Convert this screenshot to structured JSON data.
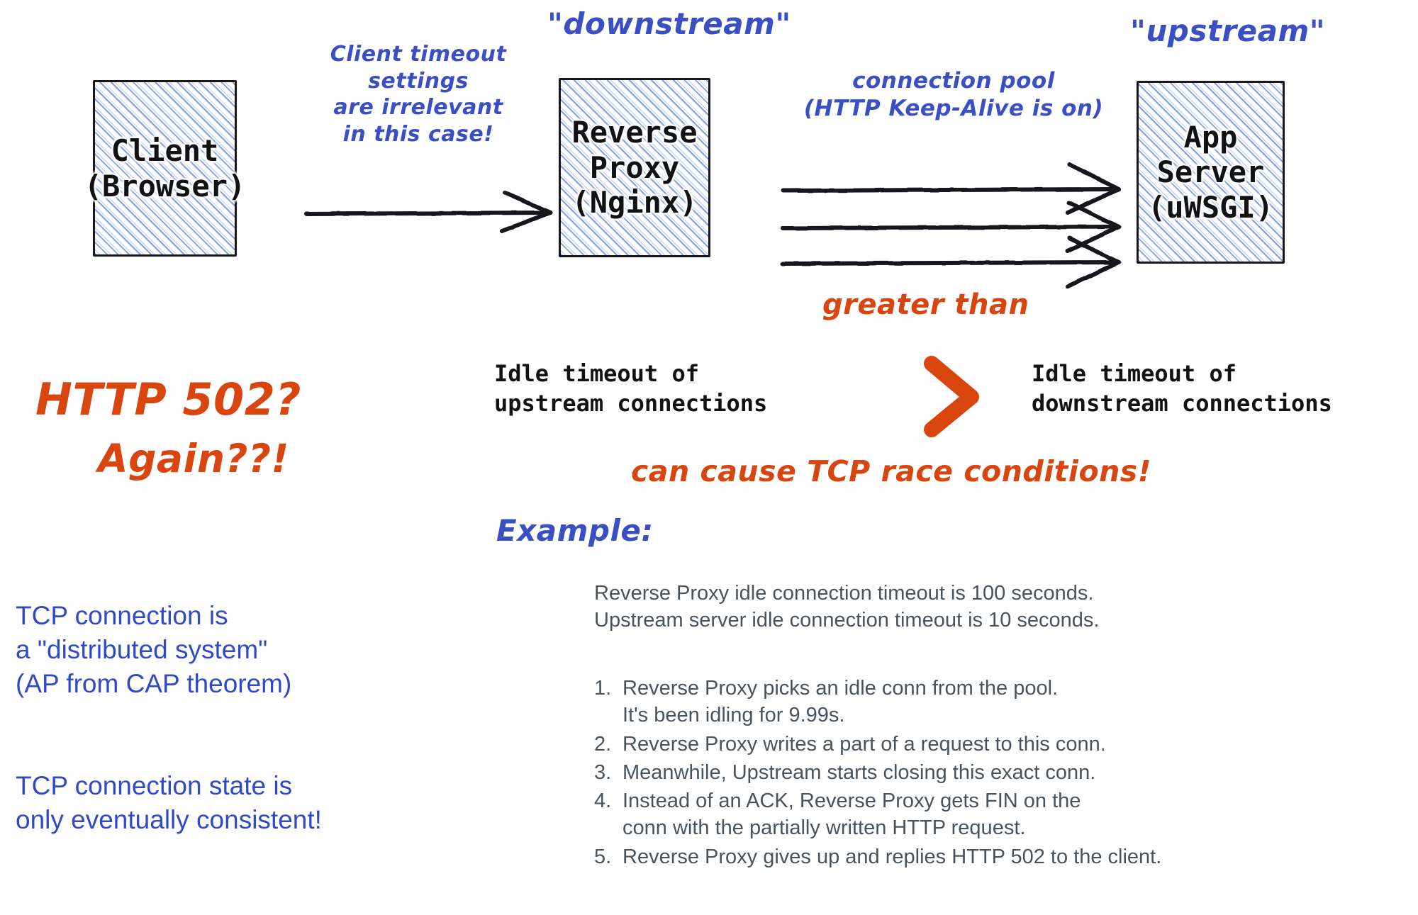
{
  "diagram": {
    "title_not_shown": "",
    "nodes": [
      {
        "id": "client",
        "label": "Client\n(Browser)"
      },
      {
        "id": "reverse_proxy",
        "label": "Reverse\nProxy\n(Nginx)"
      },
      {
        "id": "app_server",
        "label": "App\nServer\n(uWSGI)"
      }
    ],
    "stream_labels": {
      "downstream": "\"downstream\"",
      "upstream": "\"upstream\""
    },
    "annotations": {
      "client_timeout_note": "Client timeout\nsettings\nare irrelevant\nin this case!",
      "connection_pool_note": "connection pool\n(HTTP Keep-Alive is on)",
      "greater_than_note": "greater than",
      "race_condition_note": "can cause TCP race conditions!",
      "example_label": "Example:"
    },
    "comparison": {
      "left_caption": "Idle timeout of\nupstream connections",
      "operator": ">",
      "right_caption": "Idle timeout of\ndownstream connections"
    },
    "error_callout": {
      "line1": "HTTP 502?",
      "line2": "Again??!"
    },
    "takeaways": [
      "TCP connection is\na \"distributed system\"\n(AP from CAP theorem)",
      "TCP connection state is\nonly eventually consistent!"
    ],
    "example": {
      "premise": "Reverse Proxy idle connection timeout is 100 seconds.\nUpstream server idle connection timeout is 10 seconds.",
      "steps": [
        {
          "num": "1.",
          "text": "Reverse Proxy picks an idle conn from the pool.\nIt's been idling for 9.99s."
        },
        {
          "num": "2.",
          "text": "Reverse Proxy writes a part of a request to this conn."
        },
        {
          "num": "3.",
          "text": "Meanwhile, Upstream starts closing this exact conn."
        },
        {
          "num": "4.",
          "text": "Instead of an ACK, Reverse Proxy gets FIN on the\nconn with the partially written HTTP request."
        },
        {
          "num": "5.",
          "text": "Reverse Proxy gives up and replies HTTP 502 to the client."
        }
      ]
    },
    "colors": {
      "ink_black": "#16181c",
      "hatch_blue": "#6e8ceb",
      "hand_blue": "#3a4fc4",
      "prose_blue": "#2f4ac4",
      "accent_orange": "#d8450e",
      "body_gray": "#48535c",
      "background": "#ffffff"
    },
    "icons": {
      "flow_arrow": "arrow-right-icon",
      "pool_arrows": "triple-arrow-right-icon",
      "greater_than_chevron": "greater-than-chevron-icon"
    }
  }
}
